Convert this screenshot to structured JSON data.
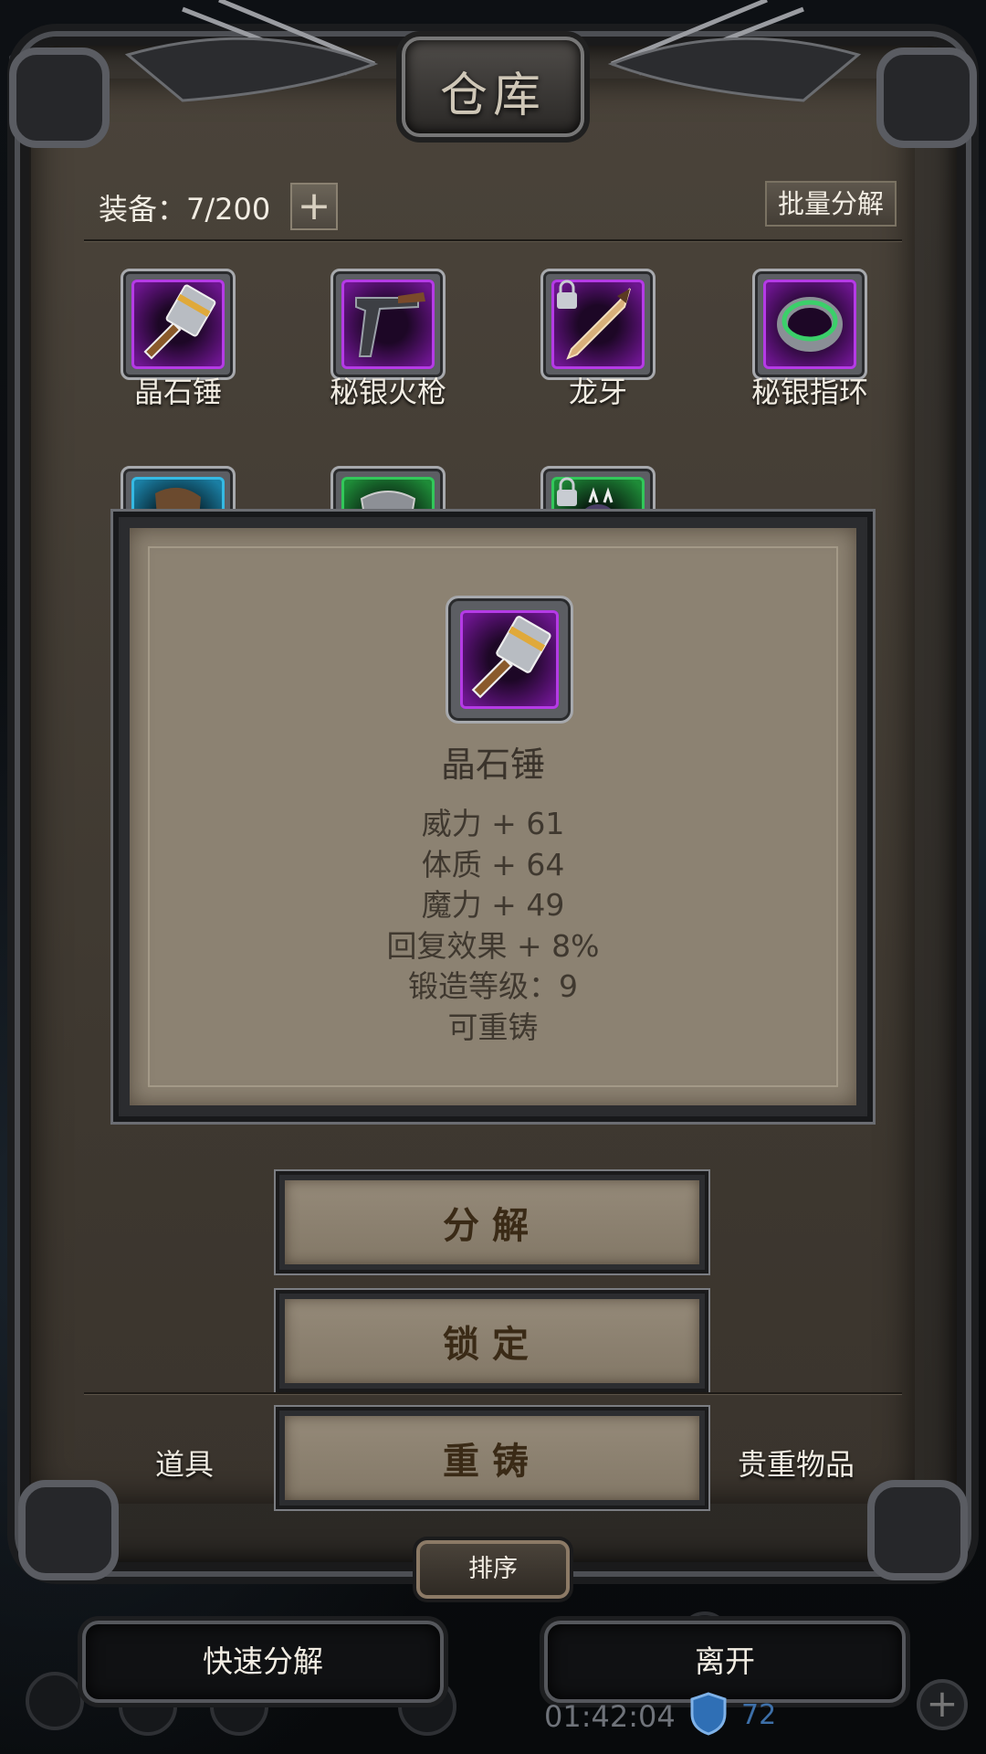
{
  "window": {
    "title": "仓库"
  },
  "header": {
    "equip_label": "装备：7/200",
    "add_label": "+",
    "batch_label": "批量分解"
  },
  "items": [
    {
      "name": "晶石锤",
      "quality": "purple",
      "icon": "hammer-icon",
      "locked": false
    },
    {
      "name": "秘银火枪",
      "quality": "purple",
      "icon": "musket-icon",
      "locked": false
    },
    {
      "name": "龙牙",
      "quality": "purple",
      "icon": "dagger-icon",
      "locked": true
    },
    {
      "name": "秘银指环",
      "quality": "purple",
      "icon": "ring-icon",
      "locked": false
    },
    {
      "name": "",
      "quality": "blue",
      "icon": "cloak-icon",
      "locked": false
    },
    {
      "name": "",
      "quality": "green",
      "icon": "armor-icon",
      "locked": false
    },
    {
      "name": "",
      "quality": "green",
      "icon": "spiked-helm-icon",
      "locked": true
    }
  ],
  "tooltip": {
    "name": "晶石锤",
    "stats": [
      "威力 + 61",
      "体质 + 64",
      "魔力 + 49",
      "回复效果 + 8%",
      "锻造等级：9",
      "可重铸"
    ]
  },
  "actions": {
    "decompose": "分解",
    "lock": "锁定",
    "reforge": "重铸"
  },
  "tabs": {
    "items": "道具",
    "valuables": "贵重物品",
    "sort": "排序"
  },
  "footer": {
    "quick_decompose": "快速分解",
    "leave": "离开",
    "timer": "01:42:04",
    "shield_count": "72"
  },
  "colors": {
    "purple_quality": "#b53be6",
    "green_quality": "#32c75a",
    "blue_quality": "#35b9e3",
    "paper": "#8c8272"
  }
}
